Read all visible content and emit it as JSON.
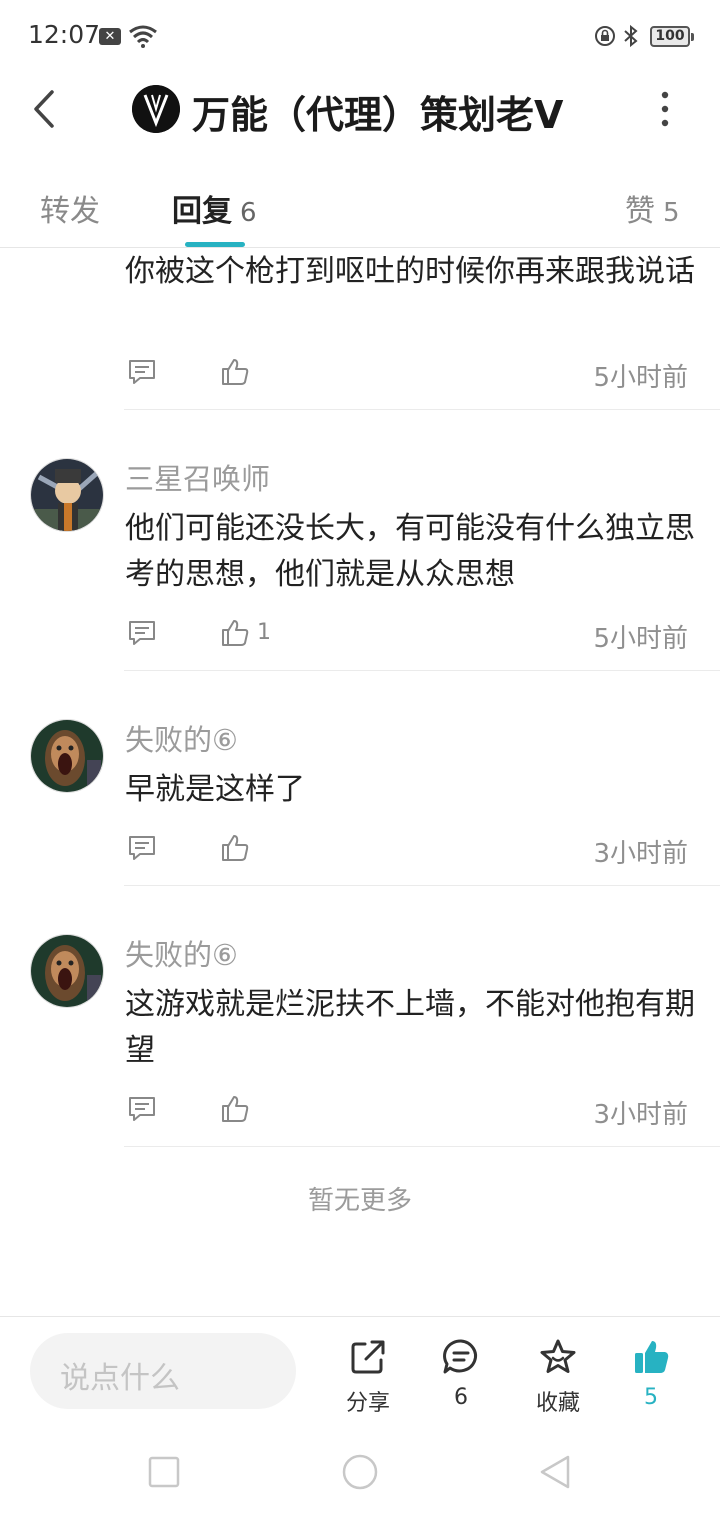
{
  "status_bar": {
    "time": "12:07",
    "battery": "100"
  },
  "header": {
    "title": "万能（代理）策划老V"
  },
  "tabs": [
    {
      "label": "转发",
      "count": ""
    },
    {
      "label": "回复",
      "count": "6"
    },
    {
      "label": "赞",
      "count": "5"
    }
  ],
  "comments": [
    {
      "author": "",
      "content": "你被这个枪打到呕吐的时候你再来跟我说话",
      "likes": "",
      "time": "5小时前"
    },
    {
      "author": "三星召唤师",
      "content": "他们可能还没长大，有可能没有什么独立思考的思想，他们就是从众思想",
      "likes": "1",
      "time": "5小时前"
    },
    {
      "author": "失败的⑥",
      "content": "早就是这样了",
      "likes": "",
      "time": "3小时前"
    },
    {
      "author": "失败的⑥",
      "content": "这游戏就是烂泥扶不上墙，不能对他抱有期望",
      "likes": "",
      "time": "3小时前"
    }
  ],
  "no_more_text": "暂无更多",
  "bottom_bar": {
    "input_placeholder": "说点什么",
    "share_label": "分享",
    "comment_count": "6",
    "favorite_label": "收藏",
    "like_count": "5"
  },
  "colors": {
    "accent": "#27b2c2"
  }
}
